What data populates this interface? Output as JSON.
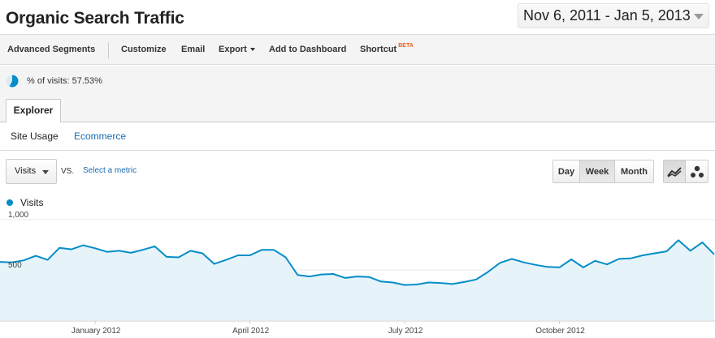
{
  "header": {
    "title": "Organic Search Traffic",
    "date_range": "Nov 6, 2011 - Jan 5, 2013"
  },
  "toolbar": {
    "advanced_segments": "Advanced Segments",
    "customize": "Customize",
    "email": "Email",
    "export": "Export",
    "add_to_dashboard": "Add to Dashboard",
    "shortcut": "Shortcut",
    "beta": "BETA"
  },
  "segment": {
    "label": "% of visits: 57.53%",
    "share": 0.5753
  },
  "tabs": {
    "explorer": "Explorer"
  },
  "subtabs": {
    "site_usage": "Site Usage",
    "ecommerce": "Ecommerce"
  },
  "controls": {
    "metric": "Visits",
    "vs": "VS.",
    "select_metric": "Select a metric",
    "periods": [
      "Day",
      "Week",
      "Month"
    ],
    "active_period": "Week"
  },
  "legend": {
    "series": "Visits"
  },
  "colors": {
    "series": "#058dc7",
    "area_fill": "#e6f4fa",
    "link": "#1a6ab0",
    "beta": "#e8601e"
  },
  "chart_data": {
    "type": "area",
    "series": [
      {
        "name": "Visits",
        "values": [
          580,
          575,
          595,
          640,
          600,
          720,
          705,
          745,
          715,
          680,
          690,
          670,
          700,
          735,
          630,
          625,
          690,
          665,
          560,
          600,
          645,
          645,
          700,
          700,
          625,
          450,
          435,
          455,
          460,
          420,
          435,
          430,
          385,
          375,
          350,
          355,
          375,
          370,
          360,
          380,
          405,
          480,
          570,
          610,
          575,
          550,
          530,
          525,
          605,
          525,
          590,
          555,
          610,
          615,
          645,
          665,
          685,
          795,
          690,
          775,
          655
        ]
      }
    ],
    "x_tick_labels": [
      "January 2012",
      "April 2012",
      "July 2012",
      "October 2012"
    ],
    "y_tick_labels": [
      "1,000",
      "500"
    ],
    "ylim": [
      0,
      1000
    ],
    "grid": true
  }
}
